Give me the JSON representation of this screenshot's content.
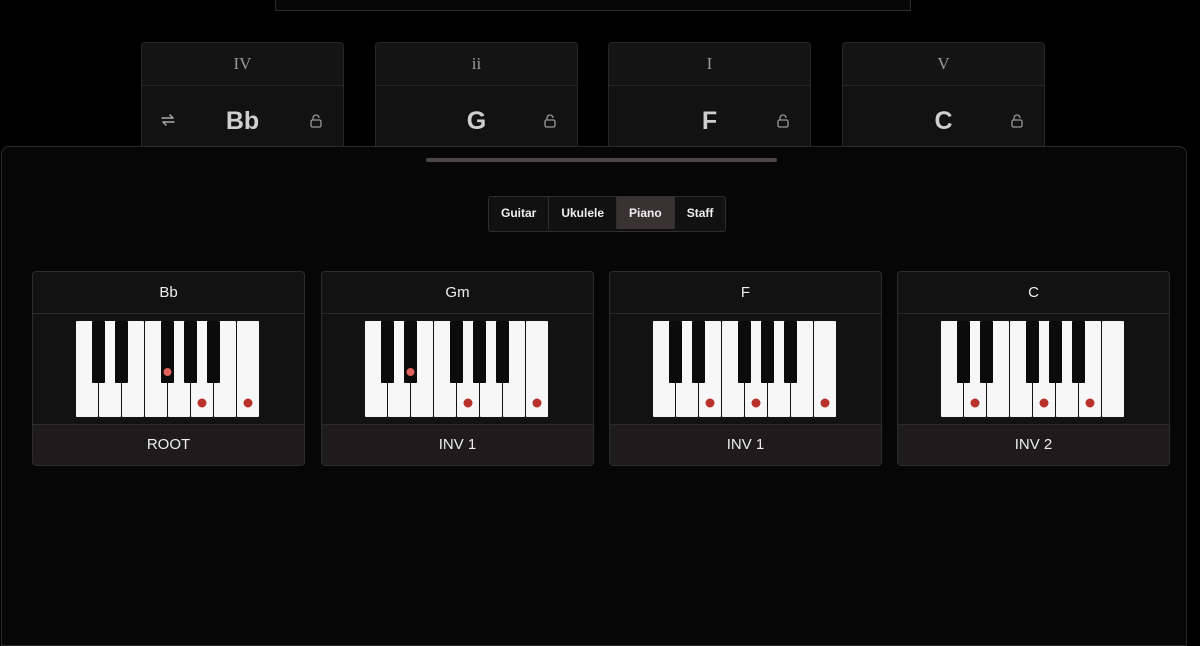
{
  "progression": [
    {
      "numeral": "IV",
      "chord": "Bb",
      "has_swap": true
    },
    {
      "numeral": "ii",
      "chord": "G",
      "has_swap": false
    },
    {
      "numeral": "I",
      "chord": "F",
      "has_swap": false
    },
    {
      "numeral": "V",
      "chord": "C",
      "has_swap": false
    }
  ],
  "instrument_tabs": [
    "Guitar",
    "Ukulele",
    "Piano",
    "Staff"
  ],
  "active_tab": "Piano",
  "voicings": [
    {
      "name": "Bb",
      "label": "ROOT",
      "white_dots": [
        5,
        7
      ],
      "black_dots": [
        2
      ],
      "root_dots": [
        2
      ]
    },
    {
      "name": "Gm",
      "label": "INV 1",
      "white_dots": [
        4,
        7
      ],
      "black_dots": [
        1
      ],
      "root_dots": [
        1
      ]
    },
    {
      "name": "F",
      "label": "INV 1",
      "white_dots": [
        2,
        4,
        7
      ],
      "black_dots": [],
      "root_dots": []
    },
    {
      "name": "C",
      "label": "INV 2",
      "white_dots": [
        1,
        4,
        6
      ],
      "black_dots": [],
      "root_dots": []
    }
  ],
  "icons": {
    "swap": "swap-icon",
    "lock": "lock-icon"
  },
  "colors": {
    "note_dot": "#b8322b",
    "root_dot": "#e0625a",
    "active_tab": "#3a3132"
  }
}
